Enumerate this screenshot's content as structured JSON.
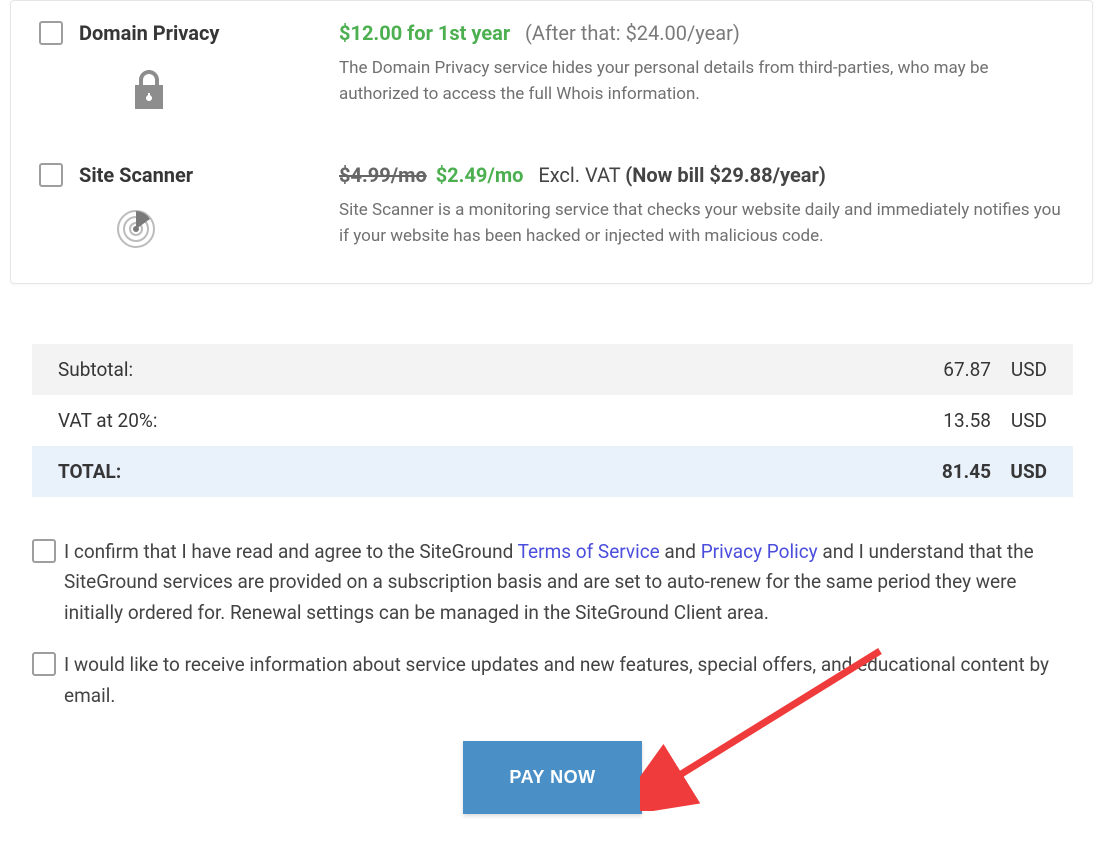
{
  "addons": {
    "domain_privacy": {
      "title": "Domain Privacy",
      "price_green": "$12.00 for 1st year",
      "price_paren": "(After that: $24.00/year)",
      "desc": "The Domain Privacy service hides your personal details from third-parties, who may be authorized to access the full Whois information."
    },
    "site_scanner": {
      "title": "Site Scanner",
      "price_strike": "$4.99/mo",
      "price_green": "$2.49/mo",
      "price_note_prefix": "Excl. VAT ",
      "price_note_bold": "(Now bill $29.88/year)",
      "desc": "Site Scanner is a monitoring service that checks your website daily and immediately notifies you if your website has been hacked or injected with malicious code."
    }
  },
  "totals": {
    "subtotal_label": "Subtotal:",
    "subtotal_amount": "67.87",
    "subtotal_cur": "USD",
    "vat_label": "VAT at 20%:",
    "vat_amount": "13.58",
    "vat_cur": "USD",
    "total_label": "TOTAL:",
    "total_amount": "81.45",
    "total_cur": "USD"
  },
  "consent": {
    "terms_1": "I confirm that I have read and agree to the SiteGround ",
    "terms_tos": "Terms of Service",
    "terms_and": " and ",
    "terms_pp": "Privacy Policy",
    "terms_2": " and I understand that the SiteGround services are provided on a subscription basis and are set to auto-renew for the same period they were initially ordered for. Renewal settings can be managed in the SiteGround Client area.",
    "marketing": "I would like to receive information about service updates and new features, special offers, and educational content by email."
  },
  "pay_button": "PAY NOW"
}
